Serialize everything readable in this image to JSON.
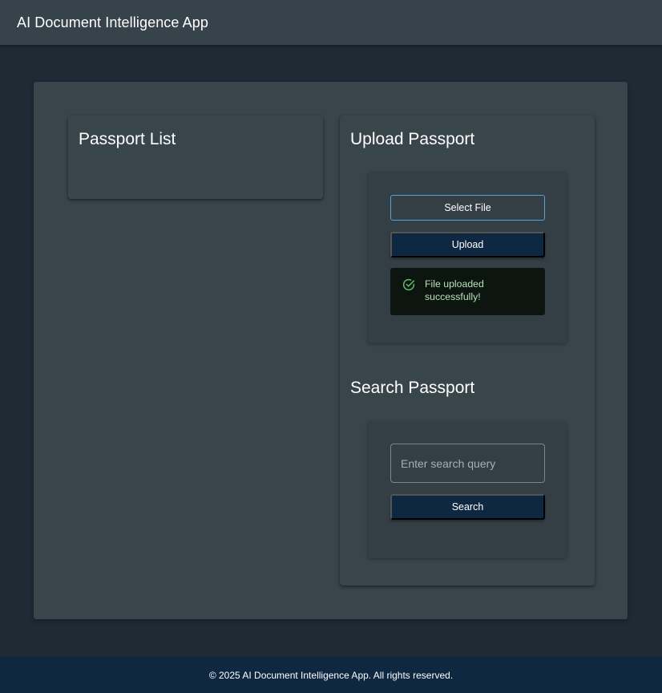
{
  "app": {
    "title": "AI Document Intelligence App"
  },
  "passport_list": {
    "title": "Passport List"
  },
  "upload": {
    "title": "Upload Passport",
    "select_file_label": "Select File",
    "upload_label": "Upload",
    "alert": {
      "icon": "check-circle-outline-icon",
      "message": "File uploaded successfully!"
    }
  },
  "search": {
    "title": "Search Passport",
    "input_value": "",
    "placeholder": "Enter search query",
    "button_label": "Search"
  },
  "footer": {
    "text": "© 2025 AI Document Intelligence App. All rights reserved."
  },
  "colors": {
    "page_background": "#1f2a35",
    "appbar": "#37434b",
    "card": "#38454b",
    "primary_button": "#0f2842",
    "outline_accent": "#4fa3d8",
    "success_background": "#0c150f",
    "success_text": "#b8e2b8",
    "success_icon": "#66bb6a",
    "footer": "#0f2842"
  }
}
